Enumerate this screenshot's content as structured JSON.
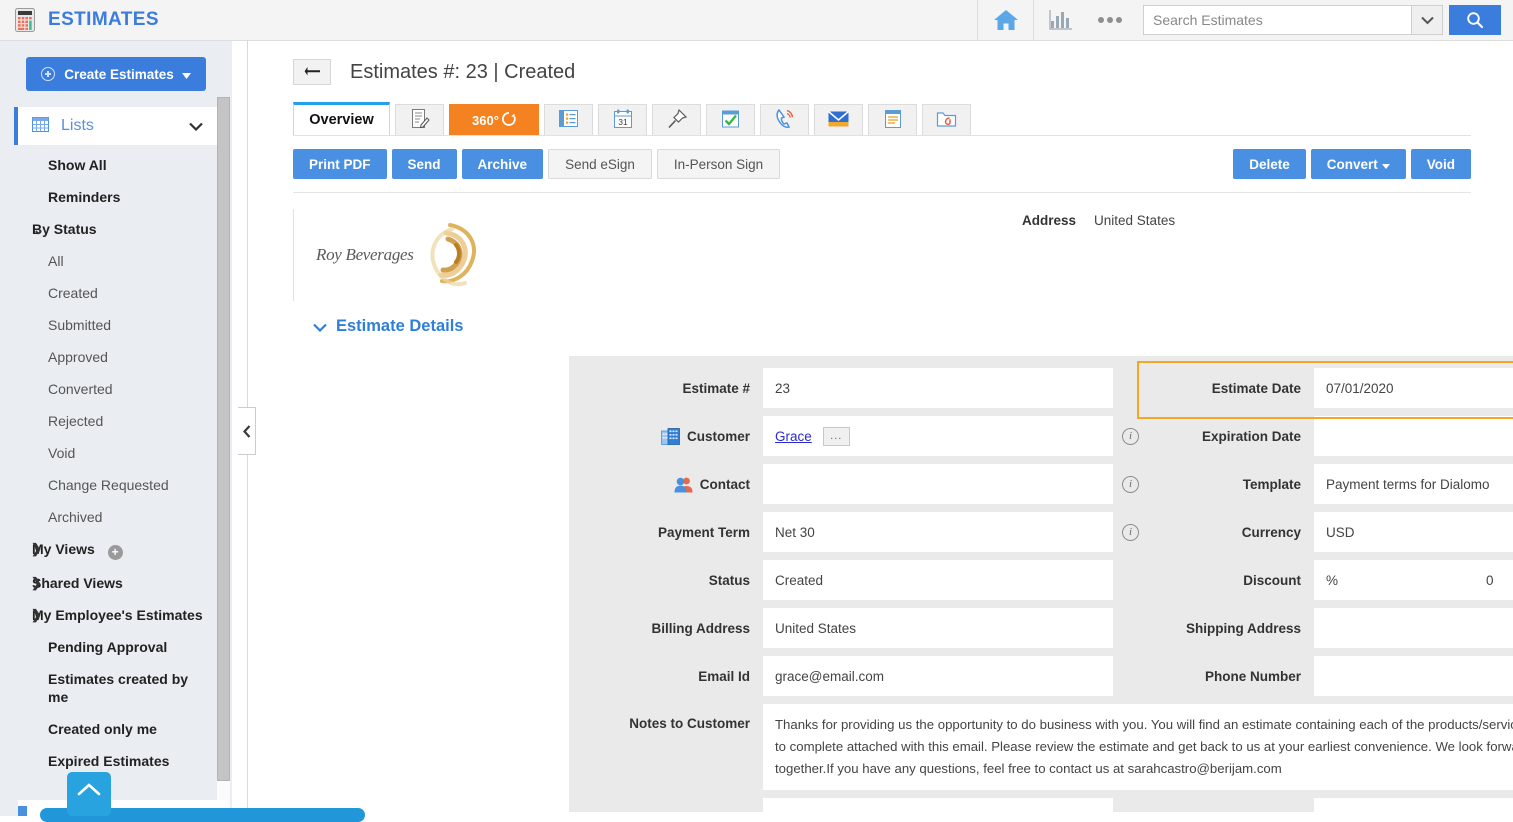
{
  "topbar": {
    "app_title": "ESTIMATES",
    "app_icon": "calculator-icon",
    "home_icon": "home-icon",
    "chart_icon": "bar-chart-icon",
    "more_icon": "ellipsis-icon",
    "search_placeholder": "Search Estimates",
    "search_value": "",
    "search_dropdown_icon": "chevron-down-icon",
    "search_button_icon": "search-icon",
    "accent_color": "#3b7ddd"
  },
  "sidebar": {
    "create_button": "Create Estimates",
    "lists_header": "Lists",
    "items": [
      {
        "label": "Show All",
        "type": "bold"
      },
      {
        "label": "Reminders",
        "type": "bold"
      },
      {
        "label": "By Status",
        "type": "group-open"
      },
      {
        "label": "All",
        "type": "sub"
      },
      {
        "label": "Created",
        "type": "sub"
      },
      {
        "label": "Submitted",
        "type": "sub"
      },
      {
        "label": "Approved",
        "type": "sub"
      },
      {
        "label": "Converted",
        "type": "sub"
      },
      {
        "label": "Rejected",
        "type": "sub"
      },
      {
        "label": "Void",
        "type": "sub"
      },
      {
        "label": "Change Requested",
        "type": "sub"
      },
      {
        "label": "Archived",
        "type": "sub"
      },
      {
        "label": "My Views",
        "type": "group-closed",
        "has_add": true
      },
      {
        "label": "Shared Views",
        "type": "group-closed"
      },
      {
        "label": "My Employee's Estimates",
        "type": "group-closed"
      },
      {
        "label": "Pending Approval",
        "type": "bold"
      },
      {
        "label": "Estimates created by me",
        "type": "bold"
      },
      {
        "label": "Created only me",
        "type": "bold"
      },
      {
        "label": "Expired Estimates",
        "type": "bold"
      }
    ],
    "collapse_icon": "chevron-left-icon",
    "scroll_top_icon": "chevron-up-icon"
  },
  "page": {
    "back_icon": "back-arrow-icon",
    "title": "Estimates #: 23 | Created"
  },
  "tabs": [
    {
      "label": "Overview",
      "icon": "",
      "state": "active"
    },
    {
      "label": "",
      "icon": "notes-edit-icon",
      "state": "normal"
    },
    {
      "label": "360°",
      "icon": "360-degree-icon",
      "state": "highlighted"
    },
    {
      "label": "",
      "icon": "list-card-icon",
      "state": "normal"
    },
    {
      "label": "",
      "icon": "calendar-31-icon",
      "state": "normal"
    },
    {
      "label": "",
      "icon": "pushpin-icon",
      "state": "normal"
    },
    {
      "label": "",
      "icon": "task-checkmark-icon",
      "state": "normal"
    },
    {
      "label": "",
      "icon": "phone-call-icon",
      "state": "normal"
    },
    {
      "label": "",
      "icon": "email-envelope-icon",
      "state": "normal"
    },
    {
      "label": "",
      "icon": "note-lines-icon",
      "state": "normal"
    },
    {
      "label": "",
      "icon": "attachment-folder-icon",
      "state": "normal"
    }
  ],
  "actions": {
    "left": [
      {
        "label": "Print PDF",
        "style": "primary"
      },
      {
        "label": "Send",
        "style": "primary"
      },
      {
        "label": "Archive",
        "style": "primary"
      },
      {
        "label": "Send eSign",
        "style": "ghost"
      },
      {
        "label": "In-Person Sign",
        "style": "ghost"
      }
    ],
    "right": [
      {
        "label": "Delete",
        "style": "primary"
      },
      {
        "label": "Convert",
        "style": "primary",
        "caret": true
      },
      {
        "label": "Void",
        "style": "primary"
      }
    ]
  },
  "brand": {
    "company_name": "Roy Beverages",
    "logo_icon": "swirl-logo-icon",
    "address_label": "Address",
    "address_value": "United States"
  },
  "details": {
    "section_title": "Estimate Details",
    "left_fields": [
      {
        "label": "Estimate #",
        "value": "23",
        "icon": "",
        "info": false
      },
      {
        "label": "Customer",
        "value": "Grace",
        "icon": "company-building-icon",
        "info": true,
        "link": true,
        "lookup": "..."
      },
      {
        "label": "Contact",
        "value": "",
        "icon": "contact-person-icon",
        "info": true
      },
      {
        "label": "Payment Term",
        "value": "Net 30",
        "icon": "",
        "info": true
      },
      {
        "label": "Status",
        "value": "Created",
        "icon": "",
        "info": false
      },
      {
        "label": "Billing Address",
        "value": "United States",
        "icon": "",
        "info": false
      },
      {
        "label": "Email Id",
        "value": "grace@email.com",
        "icon": "",
        "info": false
      }
    ],
    "right_fields": [
      {
        "label": "Estimate Date",
        "value": "07/01/2020",
        "info": false,
        "highlighted": true
      },
      {
        "label": "Expiration Date",
        "value": "",
        "info": false
      },
      {
        "label": "Template",
        "value": "Payment terms for Dialomo",
        "info": false
      },
      {
        "label": "Currency",
        "value": "USD",
        "info": true
      },
      {
        "label": "Discount",
        "value": "0",
        "prefix": "%",
        "info": true
      },
      {
        "label": "Shipping Address",
        "value": "",
        "info": false
      },
      {
        "label": "Phone Number",
        "value": "",
        "info": false
      }
    ],
    "notes_label": "Notes to Customer",
    "notes_value": "Thanks for providing us the opportunity to do business with you. You will find an estimate containing each of the products/services we are proposing to complete attached with this email. Please review the estimate and get back to us at your earliest convenience. We look forward to doing business together.If you have any questions, feel free to contact us at sarahcastro@berijam.com"
  },
  "colors": {
    "primary_blue": "#4a90e2",
    "link_blue": "#2f7fd6",
    "highlight_orange": "#f5a623",
    "tab_orange": "#f58220",
    "panel_grey": "#eaeaea"
  }
}
